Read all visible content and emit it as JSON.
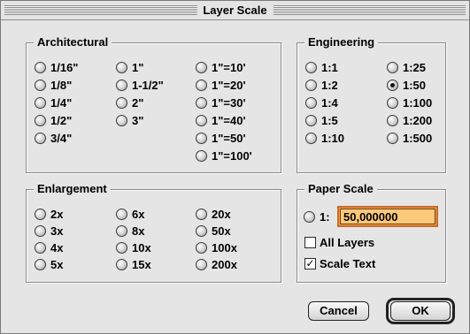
{
  "window": {
    "title": "Layer Scale"
  },
  "architectural": {
    "title": "Architectural",
    "options": [
      "1/16\"",
      "1/8\"",
      "1/4\"",
      "1/2\"",
      "3/4\"",
      "1\"",
      "1-1/2\"",
      "2\"",
      "3\"",
      "1\"=10'",
      "1\"=20'",
      "1\"=30'",
      "1\"=40'",
      "1\"=50'",
      "1\"=100'"
    ]
  },
  "engineering": {
    "title": "Engineering",
    "options": [
      "1:1",
      "1:2",
      "1:4",
      "1:5",
      "1:10",
      "1:25",
      "1:50",
      "1:100",
      "1:200",
      "1:500"
    ],
    "selected": "1:50"
  },
  "enlargement": {
    "title": "Enlargement",
    "options": [
      "2x",
      "3x",
      "4x",
      "5x",
      "6x",
      "8x",
      "10x",
      "15x",
      "20x",
      "50x",
      "100x",
      "200x"
    ]
  },
  "paper_scale": {
    "title": "Paper Scale",
    "custom_label": "1:",
    "value": "50,000000",
    "all_layers_label": "All Layers",
    "all_layers_checked": false,
    "scale_text_label": "Scale Text",
    "scale_text_checked": true
  },
  "buttons": {
    "cancel": "Cancel",
    "ok": "OK"
  }
}
